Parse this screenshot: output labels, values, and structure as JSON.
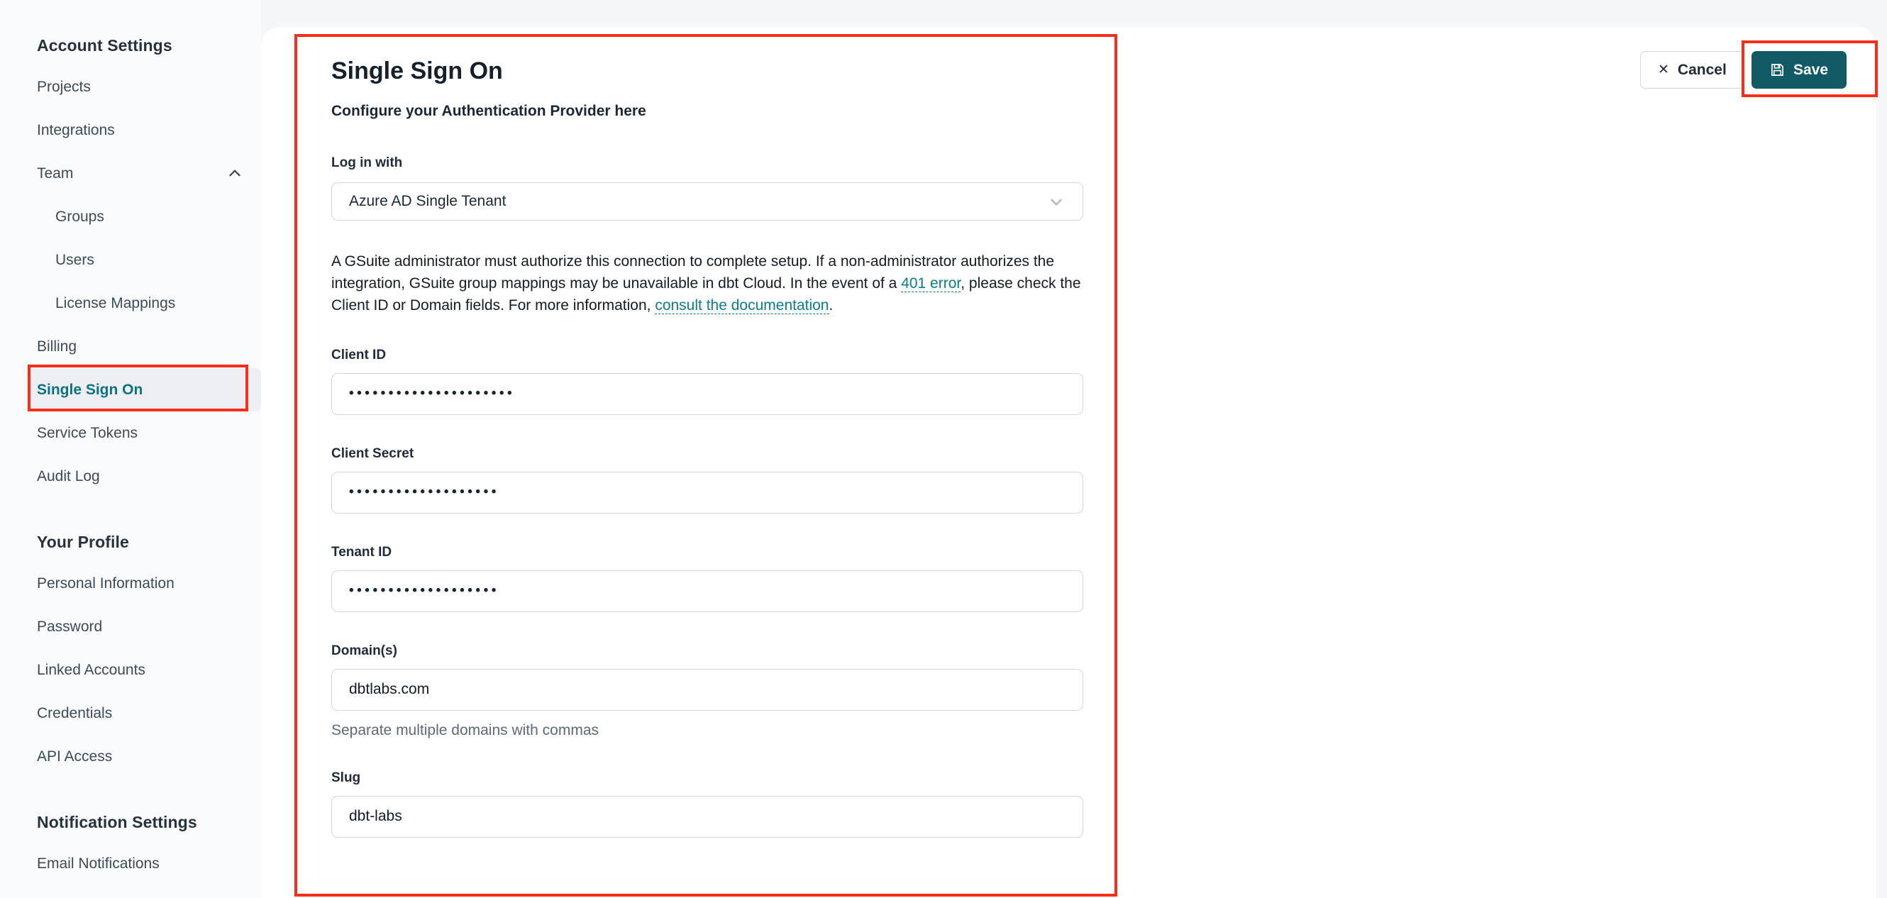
{
  "colors": {
    "accent_teal": "#0d7280",
    "save_button_bg": "#0f5a64",
    "annotation_red": "#fa2c1a",
    "sidebar_bg": "#fafbfc",
    "page_bg": "#f4f6f8"
  },
  "sidebar": {
    "sections": [
      {
        "header": "Account Settings",
        "items": [
          {
            "label": "Projects"
          },
          {
            "label": "Integrations"
          },
          {
            "label": "Team"
          },
          {
            "label": "Groups"
          },
          {
            "label": "Users"
          },
          {
            "label": "License Mappings"
          },
          {
            "label": "Billing"
          },
          {
            "label": "Single Sign On"
          },
          {
            "label": "Service Tokens"
          },
          {
            "label": "Audit Log"
          }
        ]
      },
      {
        "header": "Your Profile",
        "items": [
          {
            "label": "Personal Information"
          },
          {
            "label": "Password"
          },
          {
            "label": "Linked Accounts"
          },
          {
            "label": "Credentials"
          },
          {
            "label": "API Access"
          }
        ]
      },
      {
        "header": "Notification Settings",
        "items": [
          {
            "label": "Email Notifications"
          }
        ]
      }
    ]
  },
  "main": {
    "title": "Single Sign On",
    "subtitle": "Configure your Authentication Provider here",
    "login_with": {
      "label": "Log in with",
      "value": "Azure AD Single Tenant"
    },
    "description": {
      "part1": "A GSuite administrator must authorize this connection to complete setup. If a non-administrator authorizes the integration, GSuite group mappings may be unavailable in dbt Cloud. In the event of a ",
      "link1": "401 error",
      "part2": ", please check the Client ID or Domain fields. For more information, ",
      "link2": "consult the documentation",
      "part3": "."
    },
    "fields": [
      {
        "label": "Client ID",
        "value": "•••••••••••••••••••••"
      },
      {
        "label": "Client Secret",
        "value": "•••••••••••••••••••"
      },
      {
        "label": "Tenant ID",
        "value": "•••••••••••••••••••"
      },
      {
        "label": "Domain(s)",
        "value": "dbtlabs.com",
        "helper": "Separate multiple domains with commas"
      },
      {
        "label": "Slug",
        "value": "dbt-labs"
      }
    ],
    "buttons": {
      "cancel": "Cancel",
      "save": "Save"
    }
  }
}
